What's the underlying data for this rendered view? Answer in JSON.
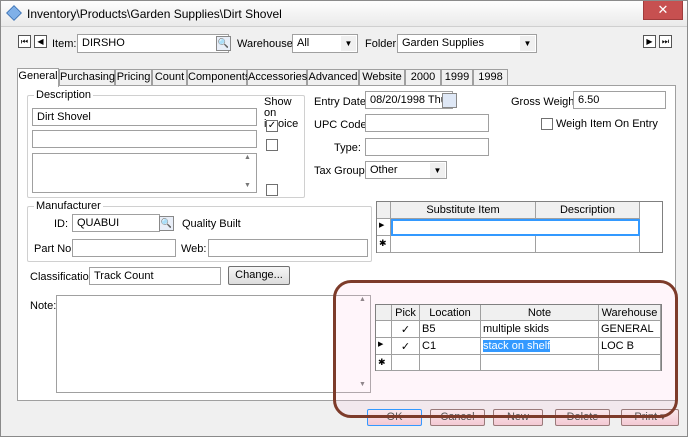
{
  "window": {
    "title": "Inventory\\Products\\Garden Supplies\\Dirt Shovel",
    "close_glyph": "✕"
  },
  "toolbar": {
    "item_label": "Item:",
    "item_value": "DIRSHO",
    "warehouse_label": "Warehouse:",
    "warehouse_value": "All",
    "folder_label": "Folder:",
    "folder_value": "Garden Supplies"
  },
  "tabs": [
    "General",
    "Purchasing",
    "Pricing",
    "Count",
    "Components",
    "Accessories",
    "Advanced",
    "Website",
    "2000",
    "1999",
    "1998"
  ],
  "description": {
    "title": "Description",
    "show_on_invoice": "Show on invoice",
    "line1": "Dirt Shovel",
    "line2": "",
    "line3": ""
  },
  "manufacturer": {
    "title": "Manufacturer",
    "id_label": "ID:",
    "id_value": "QUABUI",
    "name": "Quality Built",
    "partno_label": "Part No:",
    "partno_value": "",
    "web_label": "Web:",
    "web_value": ""
  },
  "classification": {
    "label": "Classification:",
    "value": "Track Count",
    "change_button": "Change..."
  },
  "note": {
    "label": "Note:",
    "value": ""
  },
  "details": {
    "entry_date_label": "Entry Date:",
    "entry_date_value": "08/20/1998 Thu",
    "upc_label": "UPC Code:",
    "upc_value": "",
    "type_label": "Type:",
    "type_value": "",
    "taxgroup_label": "Tax Group:",
    "taxgroup_value": "Other",
    "gross_weight_label": "Gross Weight:",
    "gross_weight_value": "6.50",
    "weigh_on_entry_label": "Weigh Item On Entry"
  },
  "substitute_grid": {
    "columns": [
      "Substitute Item",
      "Description"
    ]
  },
  "location_grid": {
    "columns": [
      "Pick",
      "Location",
      "Note",
      "Warehouse"
    ],
    "rows": [
      {
        "pick": "✓",
        "location": "B5",
        "note": "multiple skids",
        "warehouse": "GENERAL"
      },
      {
        "pick": "✓",
        "location": "C1",
        "note": "stack on shelf",
        "warehouse": "LOC B"
      }
    ]
  },
  "buttons": {
    "ok": "OK",
    "cancel": "Cancel",
    "new": "New",
    "delete": "Delete",
    "print": "Print ▾"
  },
  "icons": {
    "check": "✓",
    "row_pointer": "▶",
    "new_row": "✱",
    "dropdown": "▼",
    "scroll_up": "▲",
    "scroll_down": "▼",
    "nav_first": "⏮",
    "nav_prev": "◀",
    "nav_next": "▶",
    "nav_last": "⏭",
    "lookup": "🔍"
  },
  "colors": {
    "highlight_oval": "#7d3b2a",
    "selection": "#3399ff"
  }
}
